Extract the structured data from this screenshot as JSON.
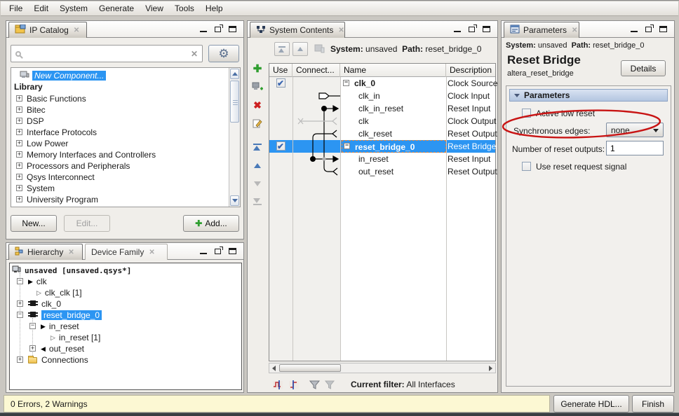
{
  "menu": {
    "items": [
      "File",
      "Edit",
      "System",
      "Generate",
      "View",
      "Tools",
      "Help"
    ]
  },
  "icons": {
    "close": "✕",
    "gear": "⚙",
    "plus": "✚",
    "delete": "✖",
    "port_out": "▶",
    "port_export": "▷",
    "port_in": "◀"
  },
  "ip_catalog": {
    "tab": "IP Catalog",
    "search_value": "",
    "tree": {
      "new_component": "New Component...",
      "library_header": "Library",
      "items": [
        "Basic Functions",
        "Bitec",
        "DSP",
        "Interface Protocols",
        "Low Power",
        "Memory Interfaces and Controllers",
        "Processors and Peripherals",
        "Qsys Interconnect",
        "System",
        "University Program"
      ]
    },
    "buttons": {
      "new": "New...",
      "edit": "Edit...",
      "add": "Add..."
    }
  },
  "hierarchy": {
    "tab": "Hierarchy",
    "tab2": "Device Family",
    "items": [
      {
        "label": "unsaved [unsaved.qsys*]"
      },
      {
        "label": "clk"
      },
      {
        "label": "clk_clk [1]"
      },
      {
        "label": "clk_0"
      },
      {
        "label": "reset_bridge_0"
      },
      {
        "label": "in_reset"
      },
      {
        "label": "in_reset [1]"
      },
      {
        "label": "out_reset"
      },
      {
        "label": "Connections"
      }
    ]
  },
  "system_contents": {
    "tab": "System Contents",
    "system_label": "System:",
    "system_value": "unsaved",
    "path_label": "Path:",
    "path_value": "reset_bridge_0",
    "columns": [
      "Use",
      "Connect...",
      "Name",
      "Description"
    ],
    "rows": [
      {
        "name": "clk_0",
        "desc": "Clock Source"
      },
      {
        "name": "clk_in",
        "desc": "Clock Input"
      },
      {
        "name": "clk_in_reset",
        "desc": "Reset Input"
      },
      {
        "name": "clk",
        "desc": "Clock Output"
      },
      {
        "name": "clk_reset",
        "desc": "Reset Output"
      },
      {
        "name": "reset_bridge_0",
        "desc": "Reset Bridge"
      },
      {
        "name": "in_reset",
        "desc": "Reset Input"
      },
      {
        "name": "out_reset",
        "desc": "Reset Output"
      }
    ],
    "filter_label": "Current filter:",
    "filter_value": "All Interfaces"
  },
  "parameters": {
    "tab": "Parameters",
    "system_label": "System:",
    "system_value": "unsaved",
    "path_label": "Path:",
    "path_value": "reset_bridge_0",
    "title": "Reset Bridge",
    "subtitle": "altera_reset_bridge",
    "details_button": "Details",
    "section_title": "Parameters",
    "active_low_label": "Active low reset",
    "sync_edges_label": "Synchronous edges:",
    "sync_edges_value": "none",
    "num_outputs_label": "Number of reset outputs:",
    "num_outputs_value": "1",
    "use_reset_request_label": "Use reset request signal"
  },
  "status_bar": {
    "message": "0 Errors, 2 Warnings",
    "generate_button": "Generate HDL...",
    "finish_button": "Finish"
  },
  "colors": {
    "selection": "#2c95f2",
    "annotation": "#c81414",
    "status_bg": "#fcf8d3"
  }
}
